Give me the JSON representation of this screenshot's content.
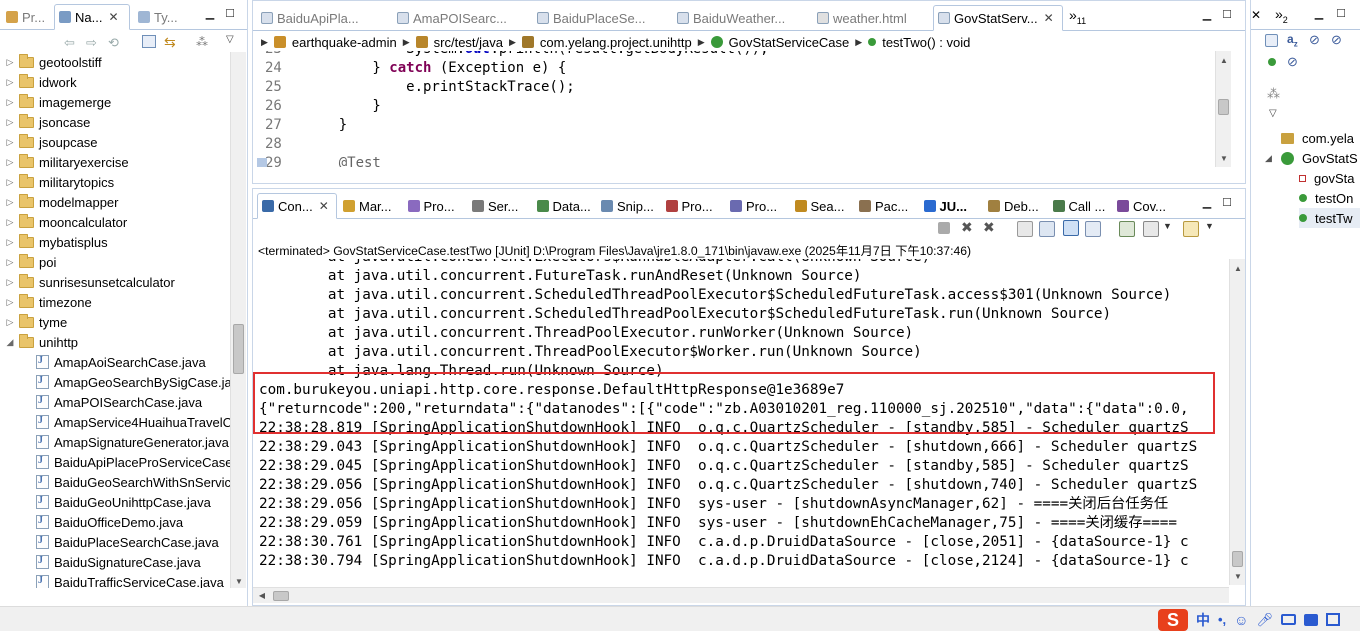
{
  "left_view": {
    "tabs": [
      {
        "label": "Pr...",
        "active": false
      },
      {
        "label": "Na...",
        "active": true
      },
      {
        "label": "Ty...",
        "active": false
      }
    ],
    "tree": [
      {
        "label": "geotoolstiff",
        "type": "folder",
        "expanded": false
      },
      {
        "label": "idwork",
        "type": "folder",
        "expanded": false
      },
      {
        "label": "imagemerge",
        "type": "folder",
        "expanded": false
      },
      {
        "label": "jsoncase",
        "type": "folder",
        "expanded": false
      },
      {
        "label": "jsoupcase",
        "type": "folder",
        "expanded": false
      },
      {
        "label": "militaryexercise",
        "type": "folder",
        "expanded": false
      },
      {
        "label": "militarytopics",
        "type": "folder",
        "expanded": false
      },
      {
        "label": "modelmapper",
        "type": "folder",
        "expanded": false
      },
      {
        "label": "mooncalculator",
        "type": "folder",
        "expanded": false
      },
      {
        "label": "mybatisplus",
        "type": "folder",
        "expanded": false
      },
      {
        "label": "poi",
        "type": "folder",
        "expanded": false
      },
      {
        "label": "sunrisesunsetcalculator",
        "type": "folder",
        "expanded": false
      },
      {
        "label": "timezone",
        "type": "folder",
        "expanded": false
      },
      {
        "label": "tyme",
        "type": "folder",
        "expanded": false
      },
      {
        "label": "unihttp",
        "type": "folder",
        "expanded": true
      },
      {
        "label": "AmapAoiSearchCase.java",
        "type": "file"
      },
      {
        "label": "AmapGeoSearchBySigCase.java",
        "type": "file"
      },
      {
        "label": "AmaPOISearchCase.java",
        "type": "file"
      },
      {
        "label": "AmapService4HuaihuaTravelCase.java",
        "type": "file"
      },
      {
        "label": "AmapSignatureGenerator.java",
        "type": "file"
      },
      {
        "label": "BaiduApiPlaceProServiceCase.java",
        "type": "file"
      },
      {
        "label": "BaiduGeoSearchWithSnServiceCase.java",
        "type": "file"
      },
      {
        "label": "BaiduGeoUnihttpCase.java",
        "type": "file"
      },
      {
        "label": "BaiduOfficeDemo.java",
        "type": "file"
      },
      {
        "label": "BaiduPlaceSearchCase.java",
        "type": "file"
      },
      {
        "label": "BaiduSignatureCase.java",
        "type": "file"
      },
      {
        "label": "BaiduTrafficServiceCase.java",
        "type": "file"
      }
    ]
  },
  "editor": {
    "tabs": [
      {
        "label": "BaiduApiPla...",
        "active": false
      },
      {
        "label": "AmaPOISearc...",
        "active": false
      },
      {
        "label": "BaiduPlaceSe...",
        "active": false
      },
      {
        "label": "BaiduWeather...",
        "active": false
      },
      {
        "label": "weather.html",
        "active": false
      },
      {
        "label": "GovStatServ...",
        "active": true
      }
    ],
    "overflow_label": "»",
    "overflow_count": "11",
    "breadcrumb": [
      "earthquake-admin",
      "src/test/java",
      "com.yelang.project.unihttp",
      "GovStatServiceCase",
      "testTwo() : void"
    ],
    "lines": [
      {
        "num": "23",
        "code": "            System.out.println(result.getBodyResult());"
      },
      {
        "num": "24",
        "code": "        } catch (Exception e) {"
      },
      {
        "num": "25",
        "code": "            e.printStackTrace();"
      },
      {
        "num": "26",
        "code": "        }"
      },
      {
        "num": "27",
        "code": "    }"
      },
      {
        "num": "28",
        "code": ""
      },
      {
        "num": "29",
        "code": "    @Test"
      }
    ],
    "keywords": [
      "catch"
    ]
  },
  "console": {
    "tabs": [
      {
        "label": "Con...",
        "active": true
      },
      {
        "label": "Mar...",
        "active": false
      },
      {
        "label": "Pro...",
        "active": false
      },
      {
        "label": "Ser...",
        "active": false
      },
      {
        "label": "Data...",
        "active": false
      },
      {
        "label": "Snip...",
        "active": false
      },
      {
        "label": "Pro...",
        "active": false
      },
      {
        "label": "Pro...",
        "active": false
      },
      {
        "label": "Sea...",
        "active": false
      },
      {
        "label": "Pac...",
        "active": false
      },
      {
        "label": "JU...",
        "active": false
      },
      {
        "label": "Deb...",
        "active": false
      },
      {
        "label": "Call ...",
        "active": false
      },
      {
        "label": "Cov...",
        "active": false
      }
    ],
    "status": "<terminated> GovStatServiceCase.testTwo [JUnit] D:\\Program Files\\Java\\jre1.8.0_171\\bin\\javaw.exe  (2025年11月7日 下午10:37:46)",
    "lines": [
      "        at java.util.concurrent.Executors$RunnableAdapter.call(Unknown Source)",
      "        at java.util.concurrent.FutureTask.runAndReset(Unknown Source)",
      "        at java.util.concurrent.ScheduledThreadPoolExecutor$ScheduledFutureTask.access$301(Unknown Source)",
      "        at java.util.concurrent.ScheduledThreadPoolExecutor$ScheduledFutureTask.run(Unknown Source)",
      "        at java.util.concurrent.ThreadPoolExecutor.runWorker(Unknown Source)",
      "        at java.util.concurrent.ThreadPoolExecutor$Worker.run(Unknown Source)",
      "        at java.lang.Thread.run(Unknown Source)",
      "com.burukeyou.uniapi.http.core.response.DefaultHttpResponse@1e3689e7",
      "{\"returncode\":200,\"returndata\":{\"datanodes\":[{\"code\":\"zb.A03010201_reg.110000_sj.202510\",\"data\":{\"data\":0.0,",
      "22:38:28.819 [SpringApplicationShutdownHook] INFO  o.q.c.QuartzScheduler - [standby,585] - Scheduler quartzS",
      "22:38:29.043 [SpringApplicationShutdownHook] INFO  o.q.c.QuartzScheduler - [shutdown,666] - Scheduler quartzS",
      "22:38:29.045 [SpringApplicationShutdownHook] INFO  o.q.c.QuartzScheduler - [standby,585] - Scheduler quartzS",
      "22:38:29.056 [SpringApplicationShutdownHook] INFO  o.q.c.QuartzScheduler - [shutdown,740] - Scheduler quartzS",
      "22:38:29.056 [SpringApplicationShutdownHook] INFO  sys-user - [shutdownAsyncManager,62] - ====关闭后台任务任",
      "22:38:29.059 [SpringApplicationShutdownHook] INFO  sys-user - [shutdownEhCacheManager,75] - ====关闭缓存====",
      "22:38:30.761 [SpringApplicationShutdownHook] INFO  c.a.d.p.DruidDataSource - [close,2051] - {dataSource-1} c",
      "22:38:30.794 [SpringApplicationShutdownHook] INFO  c.a.d.p.DruidDataSource - [close,2124] - {dataSource-1} c"
    ],
    "highlight_color": "#e03030"
  },
  "outline": {
    "overflow_label": "»",
    "overflow_count": "2",
    "items": [
      {
        "label": "com.yela",
        "kind": "package"
      },
      {
        "label": "GovStatS",
        "kind": "class"
      },
      {
        "label": "govSta",
        "kind": "field"
      },
      {
        "label": "testOn",
        "kind": "method"
      },
      {
        "label": "testTw",
        "kind": "method"
      }
    ]
  },
  "taskbar": {
    "ime_label": "S",
    "chars": [
      "中",
      "•,"
    ]
  }
}
